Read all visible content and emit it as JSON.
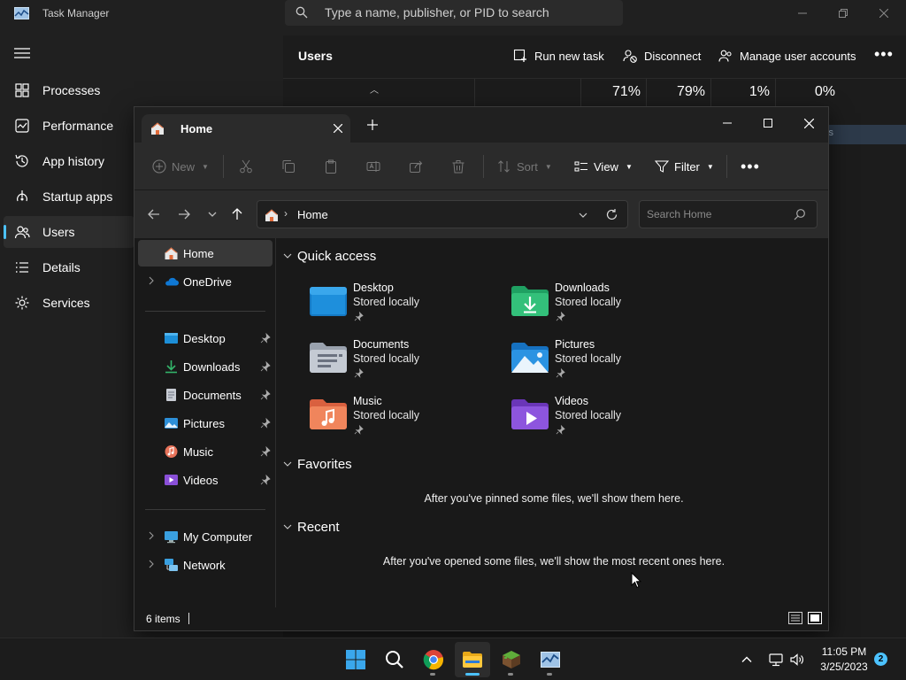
{
  "task_manager": {
    "title": "Task Manager",
    "search_placeholder": "Type a name, publisher, or PID to search",
    "nav": [
      {
        "label": "Processes",
        "icon": "processes-icon"
      },
      {
        "label": "Performance",
        "icon": "performance-icon"
      },
      {
        "label": "App history",
        "icon": "app-history-icon"
      },
      {
        "label": "Startup apps",
        "icon": "startup-apps-icon"
      },
      {
        "label": "Users",
        "icon": "users-icon",
        "active": true
      },
      {
        "label": "Details",
        "icon": "details-icon"
      },
      {
        "label": "Services",
        "icon": "services-icon"
      }
    ],
    "page_title": "Users",
    "commands": {
      "run_new_task": "Run new task",
      "disconnect": "Disconnect",
      "manage_user_accounts": "Manage user accounts"
    },
    "columns": [
      {
        "pct": "71%"
      },
      {
        "pct": "79%"
      },
      {
        "pct": "1%"
      },
      {
        "pct": "0%"
      }
    ],
    "highlight_text": "s"
  },
  "explorer": {
    "tab_label": "Home",
    "toolbar": {
      "new_label": "New",
      "sort_label": "Sort",
      "view_label": "View",
      "filter_label": "Filter"
    },
    "address": {
      "path": "Home",
      "search_placeholder": "Search Home"
    },
    "nav_pane": [
      {
        "label": "Home",
        "icon": "home-icon",
        "selected": true
      },
      {
        "label": "OneDrive",
        "icon": "onedrive-icon",
        "expandable": true
      },
      {
        "label": "Desktop",
        "icon": "desktop-folder-icon",
        "pinned": true
      },
      {
        "label": "Downloads",
        "icon": "downloads-folder-icon",
        "pinned": true
      },
      {
        "label": "Documents",
        "icon": "documents-folder-icon",
        "pinned": true
      },
      {
        "label": "Pictures",
        "icon": "pictures-folder-icon",
        "pinned": true
      },
      {
        "label": "Music",
        "icon": "music-folder-icon",
        "pinned": true
      },
      {
        "label": "Videos",
        "icon": "videos-folder-icon",
        "pinned": true
      },
      {
        "label": "My Computer",
        "icon": "computer-icon",
        "expandable": true
      },
      {
        "label": "Network",
        "icon": "network-icon",
        "expandable": true
      }
    ],
    "sections": {
      "quick_access": "Quick access",
      "favorites": "Favorites",
      "recent": "Recent"
    },
    "quick_access": [
      {
        "name": "Desktop",
        "sub": "Stored locally"
      },
      {
        "name": "Downloads",
        "sub": "Stored locally"
      },
      {
        "name": "Documents",
        "sub": "Stored locally"
      },
      {
        "name": "Pictures",
        "sub": "Stored locally"
      },
      {
        "name": "Music",
        "sub": "Stored locally"
      },
      {
        "name": "Videos",
        "sub": "Stored locally"
      }
    ],
    "favorites_empty": "After you've pinned some files, we'll show them here.",
    "recent_empty": "After you've opened some files, we'll show the most recent ones here.",
    "status_count": "6 items"
  },
  "taskbar": {
    "apps": [
      "start-icon",
      "search-icon",
      "chrome-icon",
      "file-explorer-icon",
      "minecraft-icon",
      "task-manager-icon"
    ],
    "time": "11:05 PM",
    "date": "3/25/2023",
    "notification_count": "2"
  },
  "colors": {
    "accent": "#4cc2ff",
    "window_bg": "#191919",
    "toolbar_bg": "#2b2b2b"
  }
}
